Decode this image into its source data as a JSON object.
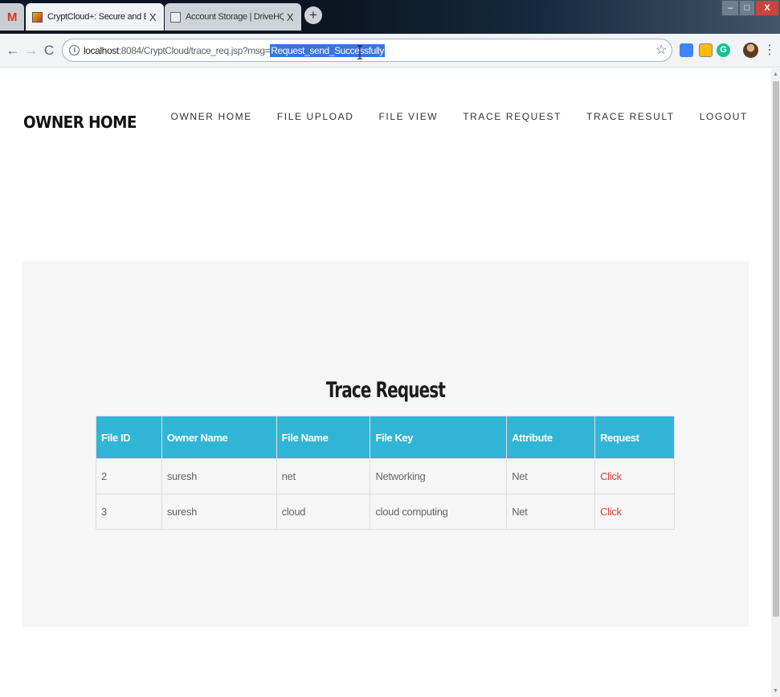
{
  "browser": {
    "tabs": [
      {
        "title": "",
        "icon": "gmail-icon"
      },
      {
        "title": "CryptCloud+: Secure and Express",
        "icon": "cryptcloud-favicon",
        "close": "X",
        "active": true
      },
      {
        "title": "Account Storage | DriveHQ",
        "icon": "drivehq-favicon",
        "close": "X",
        "active": false
      }
    ],
    "gmail_glyph": "M",
    "new_tab": "+",
    "window": {
      "minimize": "–",
      "maximize": "□",
      "close": "X"
    },
    "url": {
      "host": "localhost",
      "path": ":8084/CryptCloud/trace_req.jsp?msg=",
      "selected": "Request_send_Successfully"
    },
    "nav": {
      "back": "←",
      "forward": "→",
      "reload": "C"
    },
    "star": "☆",
    "menu": "⋮",
    "extension_grammar": "G"
  },
  "site": {
    "brand": "OWNER HOME",
    "menu": [
      "OWNER HOME",
      "FILE UPLOAD",
      "FILE VIEW",
      "TRACE REQUEST",
      "TRACE RESULT",
      "LOGOUT"
    ]
  },
  "panel": {
    "title": "Trace Request",
    "table": {
      "headers": [
        "File ID",
        "Owner Name",
        "File Name",
        "File Key",
        "Attribute",
        "Request"
      ],
      "rows": [
        [
          "2",
          "suresh",
          "net",
          "Networking",
          "Net",
          "Click"
        ],
        [
          "3",
          "suresh",
          "cloud",
          "cloud computing",
          "Net",
          "Click"
        ]
      ]
    }
  },
  "colors": {
    "table_header": "#31b5d6",
    "link": "#e2413c",
    "panel_bg": "#f6f6f6",
    "url_selection": "#3875d7"
  }
}
